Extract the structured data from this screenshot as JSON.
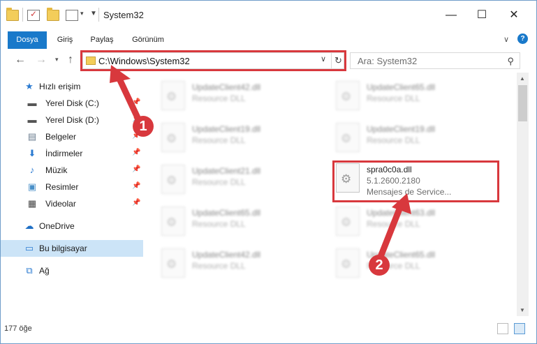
{
  "window": {
    "title": "System32",
    "minimize": "—",
    "maximize": "☐",
    "close": "✕"
  },
  "ribbon": {
    "tabs": [
      "Dosya",
      "Giriş",
      "Paylaş",
      "Görünüm"
    ],
    "expand_icon": "chevron-down-icon",
    "help_icon": "help-icon"
  },
  "address_bar": {
    "path": "C:\\Windows\\System32",
    "search_placeholder": "Ara: System32"
  },
  "sidebar": {
    "items": [
      {
        "label": "Hızlı erişim",
        "icon": "star-icon"
      },
      {
        "label": "Yerel Disk (C:)",
        "icon": "drive-icon"
      },
      {
        "label": "Yerel Disk (D:)",
        "icon": "drive-icon"
      },
      {
        "label": "Belgeler",
        "icon": "documents-icon"
      },
      {
        "label": "İndirmeler",
        "icon": "download-icon"
      },
      {
        "label": "Müzik",
        "icon": "music-icon"
      },
      {
        "label": "Resimler",
        "icon": "pictures-icon"
      },
      {
        "label": "Videolar",
        "icon": "video-icon"
      },
      {
        "label": "OneDrive",
        "icon": "cloud-icon"
      },
      {
        "label": "Bu bilgisayar",
        "icon": "computer-icon"
      },
      {
        "label": "Ağ",
        "icon": "network-icon"
      }
    ]
  },
  "files": [
    {
      "name": "UpdateClient42.dll",
      "desc": "Resource DLL"
    },
    {
      "name": "UpdateClient65.dll",
      "desc": "Resource DLL"
    },
    {
      "name": "UpdateClient19.dll",
      "desc": "Resource DLL"
    },
    {
      "name": "UpdateClient19.dll",
      "desc": "Resource DLL"
    },
    {
      "name": "UpdateClient21.dll",
      "desc": "Resource DLL"
    },
    {
      "name": "spra0c0a.dll",
      "version": "5.1.2600.2180",
      "desc": "Mensajes de Service..."
    },
    {
      "name": "UpdateClient65.dll",
      "desc": "Resource DLL"
    },
    {
      "name": "UpdateClient63.dll",
      "desc": "Resource DLL"
    },
    {
      "name": "UpdateClient42.dll",
      "desc": "Resource DLL"
    },
    {
      "name": "UpdateClient65.dll",
      "desc": "Resource DLL"
    }
  ],
  "status": {
    "item_count": "177 öğe"
  },
  "annotations": {
    "step1": "1",
    "step2": "2",
    "color": "#d8383d"
  }
}
